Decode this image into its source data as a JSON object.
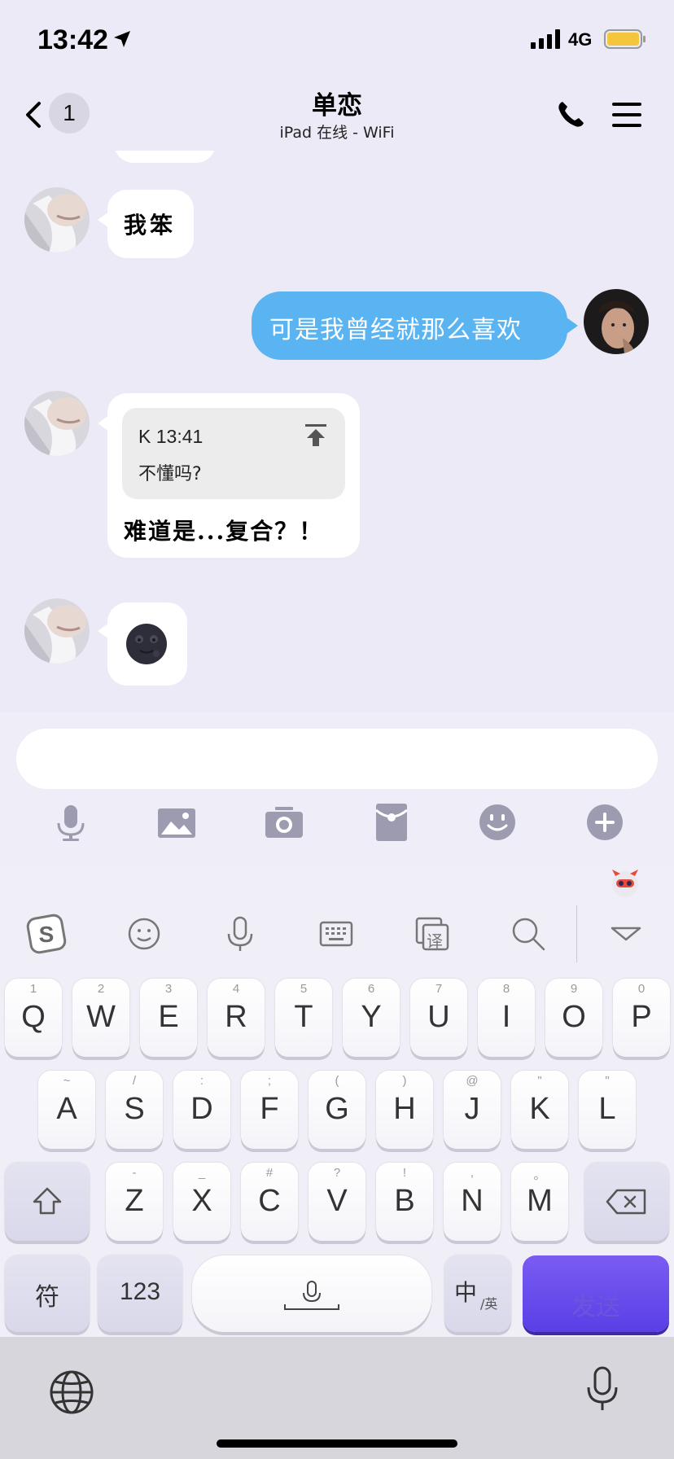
{
  "status_bar": {
    "time": "13:42",
    "network": "4G",
    "battery_color": "#f4c63d"
  },
  "nav": {
    "back_count": "1",
    "title": "单恋",
    "subtitle": "iPad 在线 - WiFi",
    "icons": [
      "back-chevron-icon",
      "phone-icon",
      "menu-icon"
    ]
  },
  "messages": [
    {
      "side": "in",
      "text": "我笨"
    },
    {
      "side": "out",
      "text": "可是我曾经就那么喜欢"
    },
    {
      "side": "in",
      "quote": {
        "header": "K 13:41",
        "text": "不懂吗?"
      },
      "text": "难道是...复合？！"
    },
    {
      "side": "in",
      "emoji": "🌚"
    }
  ],
  "input": {
    "value": "",
    "tools": [
      "microphone-icon",
      "image-icon",
      "camera-icon",
      "red-packet-icon",
      "emoji-icon",
      "plus-icon"
    ]
  },
  "keyboard": {
    "toolbar": [
      "sogou-logo-icon",
      "emoji-icon",
      "voice-icon",
      "keyboard-icon",
      "translate-icon",
      "search-icon",
      "collapse-icon"
    ],
    "translate_char": "译",
    "row1": [
      {
        "hint": "1",
        "key": "Q"
      },
      {
        "hint": "2",
        "key": "W"
      },
      {
        "hint": "3",
        "key": "E"
      },
      {
        "hint": "4",
        "key": "R"
      },
      {
        "hint": "5",
        "key": "T"
      },
      {
        "hint": "6",
        "key": "Y"
      },
      {
        "hint": "7",
        "key": "U"
      },
      {
        "hint": "8",
        "key": "I"
      },
      {
        "hint": "9",
        "key": "O"
      },
      {
        "hint": "0",
        "key": "P"
      }
    ],
    "row2": [
      {
        "hint": "~",
        "key": "A"
      },
      {
        "hint": "/",
        "key": "S"
      },
      {
        "hint": ":",
        "key": "D"
      },
      {
        "hint": ";",
        "key": "F"
      },
      {
        "hint": "(",
        "key": "G"
      },
      {
        "hint": ")",
        "key": "H"
      },
      {
        "hint": "@",
        "key": "J"
      },
      {
        "hint": "\"",
        "key": "K"
      },
      {
        "hint": "\"",
        "key": "L"
      }
    ],
    "row3": [
      {
        "hint": "-",
        "key": "Z"
      },
      {
        "hint": "_",
        "key": "X"
      },
      {
        "hint": "#",
        "key": "C"
      },
      {
        "hint": "?",
        "key": "V"
      },
      {
        "hint": "!",
        "key": "B"
      },
      {
        "hint": ",",
        "key": "N"
      },
      {
        "hint": "。",
        "key": "M"
      }
    ],
    "symbols_label": "符",
    "numbers_label": "123",
    "lang_main": "中",
    "lang_sub": "/英",
    "send_label": "发送",
    "accent_color": "#5a3fe6"
  },
  "bottom_bar": {
    "icons": [
      "globe-icon",
      "dictation-icon"
    ]
  }
}
